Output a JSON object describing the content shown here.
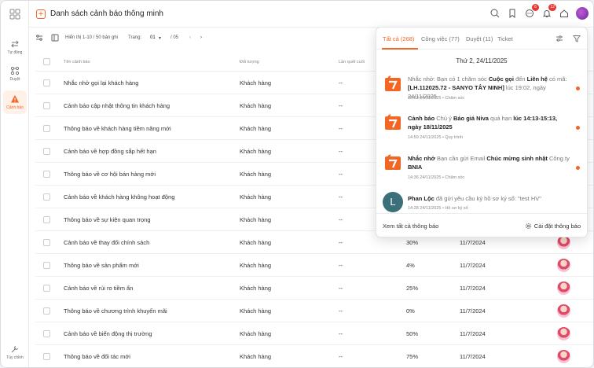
{
  "header": {
    "title": "Danh sách cảnh báo thông minh",
    "badge_chat": "6",
    "badge_bell": "12"
  },
  "rail": {
    "items": [
      "Tự động",
      "Duyệt",
      "Cảnh báo"
    ],
    "bottom": "Tùy chỉnh"
  },
  "toolbar": {
    "showing": "Hiển thị 1-10 / 50 bản ghi",
    "page_label": "Trang:",
    "page_value": "01",
    "page_total": "/ 05"
  },
  "table": {
    "headers": [
      "Tên cảnh báo",
      "Đối tượng",
      "Lần quét cuối"
    ],
    "rows": [
      {
        "name": "Nhắc nhở gọi lại khách hàng",
        "object": "Khách hàng",
        "scan": "--",
        "rate": "",
        "date": ""
      },
      {
        "name": "Cảnh báo cập nhật thông tin khách hàng",
        "object": "Khách hàng",
        "scan": "--",
        "rate": "",
        "date": ""
      },
      {
        "name": "Thông báo về khách hàng tiềm năng mới",
        "object": "Khách hàng",
        "scan": "--",
        "rate": "",
        "date": ""
      },
      {
        "name": "Cảnh báo về hợp đồng sắp hết hạn",
        "object": "Khách hàng",
        "scan": "--",
        "rate": "",
        "date": ""
      },
      {
        "name": "Thông báo về cơ hội bán hàng mới",
        "object": "Khách hàng",
        "scan": "--",
        "rate": "",
        "date": ""
      },
      {
        "name": "Cảnh báo về khách hàng không hoạt động",
        "object": "Khách hàng",
        "scan": "--",
        "rate": "",
        "date": ""
      },
      {
        "name": "Thông báo về sự kiện quan trọng",
        "object": "Khách hàng",
        "scan": "--",
        "rate": "",
        "date": ""
      },
      {
        "name": "Cảnh báo về thay đổi chính sách",
        "object": "Khách hàng",
        "scan": "--",
        "rate": "30%",
        "date": "11/7/2024"
      },
      {
        "name": "Thông báo về sản phẩm mới",
        "object": "Khách hàng",
        "scan": "--",
        "rate": "4%",
        "date": "11/7/2024"
      },
      {
        "name": "Cảnh báo về rủi ro tiềm ẩn",
        "object": "Khách hàng",
        "scan": "--",
        "rate": "25%",
        "date": "11/7/2024"
      },
      {
        "name": "Thông báo về chương trình khuyến mãi",
        "object": "Khách hàng",
        "scan": "--",
        "rate": "0%",
        "date": "11/7/2024"
      },
      {
        "name": "Cảnh báo về biến động thị trường",
        "object": "Khách hàng",
        "scan": "--",
        "rate": "50%",
        "date": "11/7/2024"
      },
      {
        "name": "Thông báo về đối tác mới",
        "object": "Khách hàng",
        "scan": "--",
        "rate": "75%",
        "date": "11/7/2024"
      }
    ]
  },
  "notifications": {
    "tabs": [
      "Tất cả (268)",
      "Công việc (77)",
      "Duyệt (11)",
      "Ticket"
    ],
    "day": "Thứ 2, 24/11/2025",
    "items": [
      {
        "t1": "Nhắc nhở: Bạn có 1 chăm sóc ",
        "b1": "Cuộc gọi",
        "t2": " đến ",
        "b2": "Liên hệ",
        "t3": " có mã: ",
        "b3": "[LH.112025.72 - SANYO TÂY NINH]",
        "t4": " lúc 19:02, ngày 24/11/2025",
        "meta": "18:52 24/11/2025   •   Chăm sóc"
      },
      {
        "b1": "Cảnh báo",
        "t1": " Chủ ý ",
        "b2": "Báo giá Niva",
        "t2": " quá hạn ",
        "b3": "lúc 14:13-15:13, ngày 18/11/2025",
        "meta": "14:59 24/11/2025   •   Quy trình"
      },
      {
        "b1": "Nhắc nhở",
        "t1": " Bạn cần gửi Email ",
        "b2": "Chúc mừng sinh nhật",
        "t2": " Công ty ",
        "b3": "BNIA",
        "meta": "14:36 24/11/2025   •   Chăm sóc"
      },
      {
        "b1": "Phan Lộc",
        "t1": " đã gửi yêu cầu ký hồ sơ ký số: \"test HV\"",
        "meta": "14:28 24/11/2025   •   Hồ sơ ký số",
        "initial": "L"
      }
    ],
    "see_all": "Xem tất cả thông báo",
    "settings": "Cài đặt thông báo"
  },
  "colors": {
    "accent": "#f26522"
  }
}
